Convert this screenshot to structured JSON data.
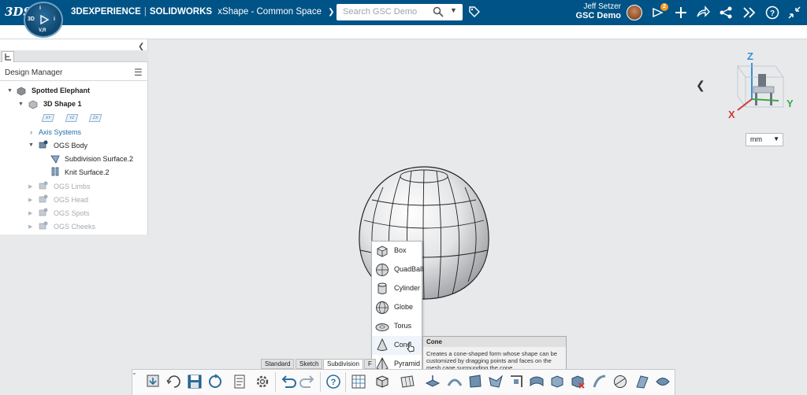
{
  "header": {
    "logo_text": "3DS",
    "brand": "3DEXPERIENCE",
    "app": "SOLIDWORKS",
    "product": "xShape - Common Space",
    "compass": {
      "north": "V,R",
      "label_3d": "3D",
      "west": "3D",
      "east": "i"
    },
    "search_placeholder": "Search GSC Demo",
    "user_name": "Jeff Setzer",
    "tenant": "GSC Demo",
    "notification_count": "2",
    "brand_color": "#005386"
  },
  "design_manager": {
    "title": "Design Manager",
    "root": "Spotted Elephant",
    "shape": "3D Shape 1",
    "planes": [
      "XY",
      "YZ",
      "ZX"
    ],
    "axis_systems": "Axis Systems",
    "body": "OGS Body",
    "body_children": [
      "Subdivision Surface.2",
      "Knit Surface.2"
    ],
    "other_bodies": [
      "OGS Limbs",
      "OGS Head",
      "OGS Spots",
      "OGS Cheeks"
    ]
  },
  "viewport": {
    "units": "mm",
    "axes": {
      "z": "Z",
      "x": "X",
      "y": "Y"
    }
  },
  "shape_menu": {
    "items": [
      {
        "label": "Box",
        "icon": "box-icon"
      },
      {
        "label": "QuadBall",
        "icon": "quadball-icon"
      },
      {
        "label": "Cylinder",
        "icon": "cylinder-icon"
      },
      {
        "label": "Globe",
        "icon": "globe-icon"
      },
      {
        "label": "Torus",
        "icon": "torus-icon"
      },
      {
        "label": "Cone",
        "icon": "cone-icon"
      },
      {
        "label": "Pyramid",
        "icon": "pyramid-icon"
      }
    ]
  },
  "tooltip": {
    "title": "Cone",
    "body": "Creates a cone-shaped form whose shape can be customized by dragging points and faces on the mesh cage surrounding the cone."
  },
  "toolbar": {
    "tabs": [
      "Standard",
      "Sketch",
      "Subdivision",
      "F"
    ],
    "active_tab": "Subdivision"
  }
}
